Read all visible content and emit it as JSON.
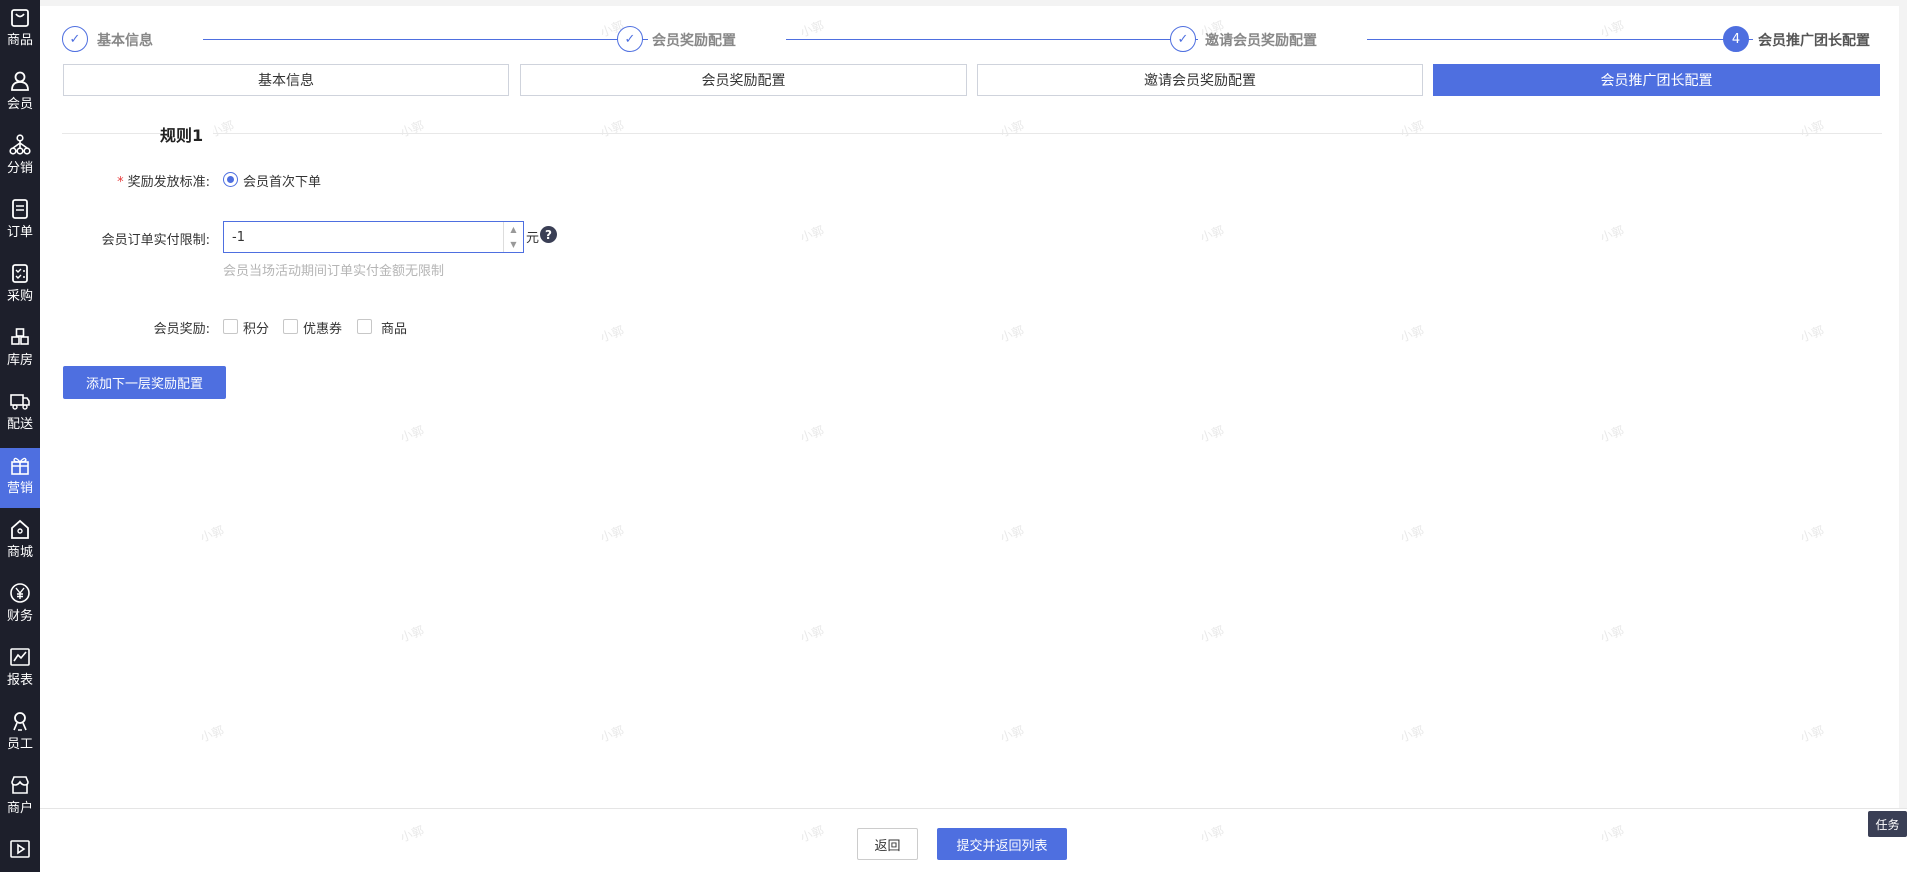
{
  "sidebar": {
    "items": [
      {
        "label": "商品",
        "icon": "bag-icon"
      },
      {
        "label": "会员",
        "icon": "user-icon"
      },
      {
        "label": "分销",
        "icon": "network-icon"
      },
      {
        "label": "订单",
        "icon": "order-doc-icon"
      },
      {
        "label": "采购",
        "icon": "checklist-icon"
      },
      {
        "label": "库房",
        "icon": "warehouse-icon"
      },
      {
        "label": "配送",
        "icon": "truck-icon"
      },
      {
        "label": "营销",
        "icon": "gift-icon"
      },
      {
        "label": "商城",
        "icon": "home-icon"
      },
      {
        "label": "财务",
        "icon": "yen-icon"
      },
      {
        "label": "报表",
        "icon": "chart-icon"
      },
      {
        "label": "员工",
        "icon": "staff-icon"
      },
      {
        "label": "商户",
        "icon": "store-icon"
      },
      {
        "label": "",
        "icon": "play-icon"
      }
    ],
    "active_index": 7,
    "active_color": "#4e6fe0"
  },
  "steps": [
    {
      "number": "✓",
      "title": "基本信息",
      "status": "done"
    },
    {
      "number": "✓",
      "title": "会员奖励配置",
      "status": "done"
    },
    {
      "number": "✓",
      "title": "邀请会员奖励配置",
      "status": "done"
    },
    {
      "number": "4",
      "title": "会员推广团长配置",
      "status": "current"
    }
  ],
  "tabs": [
    {
      "label": "基本信息",
      "active": false
    },
    {
      "label": "会员奖励配置",
      "active": false
    },
    {
      "label": "邀请会员奖励配置",
      "active": false
    },
    {
      "label": "会员推广团长配置",
      "active": true
    }
  ],
  "rule": {
    "title": "规则1",
    "standard_label": "奖励发放标准:",
    "standard_required": "*",
    "standard_option": "会员首次下单",
    "limit_label": "会员订单实付限制:",
    "limit_value": "-1",
    "limit_unit": "元",
    "limit_help": "?",
    "limit_hint": "会员当场活动期间订单实付金额无限制",
    "reward_label": "会员奖励:",
    "reward_options": [
      "积分",
      "优惠券",
      "商品"
    ]
  },
  "actions": {
    "add_layer": "添加下一层奖励配置",
    "back": "返回",
    "submit": "提交并返回列表"
  },
  "task_tab": "任务",
  "watermark": "小郭"
}
